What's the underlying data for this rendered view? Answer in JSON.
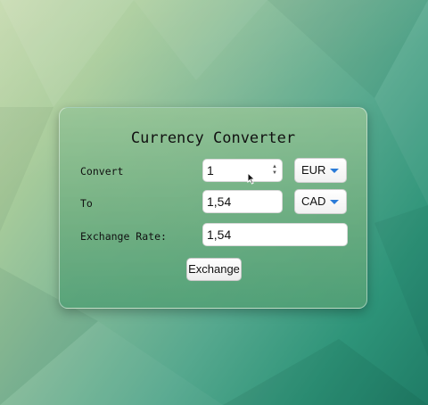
{
  "converter": {
    "title": "Currency Converter",
    "convert_label": "Convert",
    "to_label": "To",
    "rate_label": "Exchange Rate:",
    "amount_value": "1",
    "converted_value": "1,54",
    "rate_value": "1,54",
    "from_currency": "EUR",
    "to_currency": "CAD",
    "exchange_button_label": "Exchange"
  },
  "colors": {
    "select_caret": "#2a7bd8"
  }
}
